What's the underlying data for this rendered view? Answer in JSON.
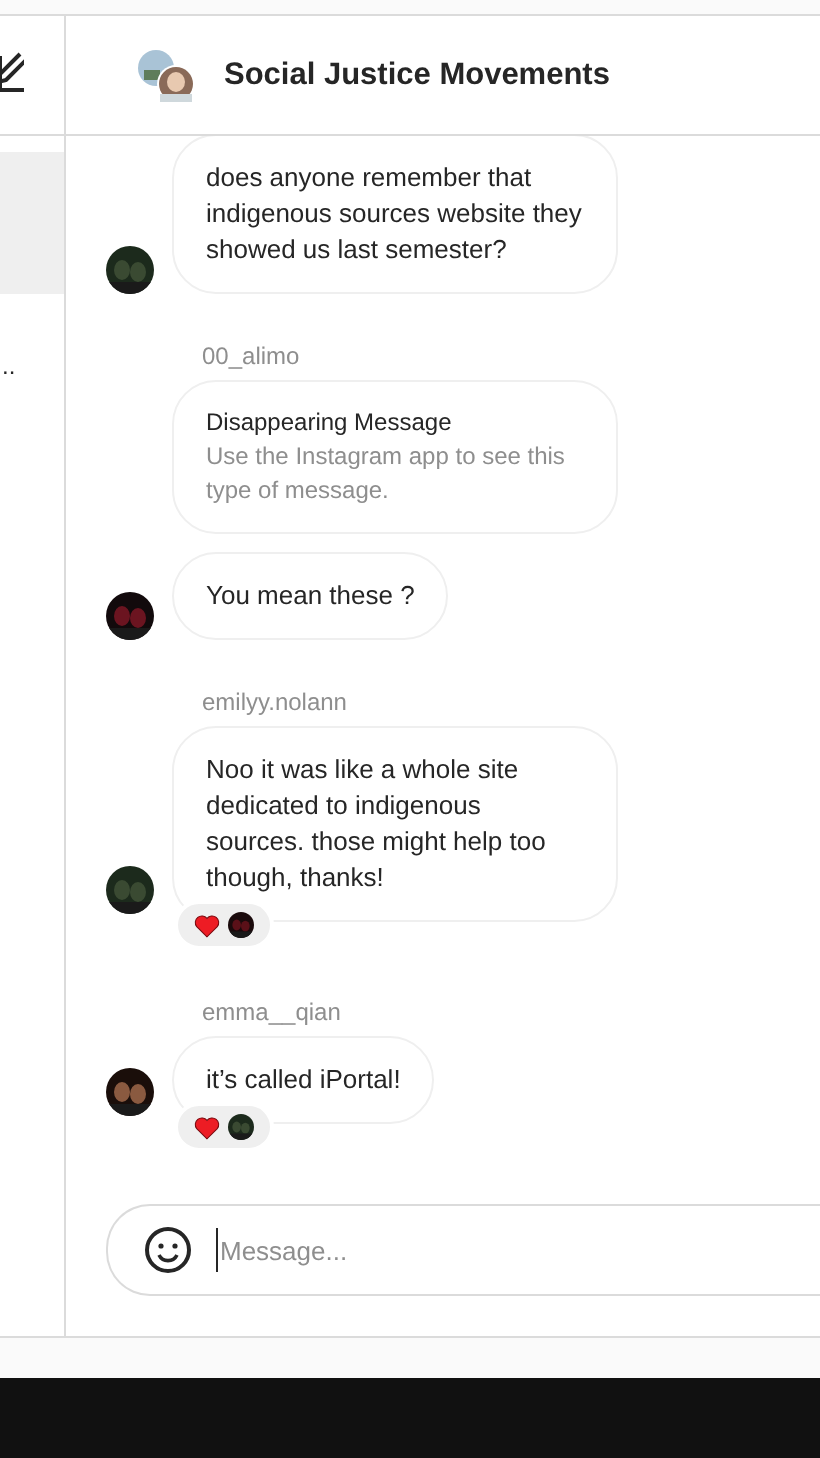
{
  "sidebar": {
    "items": [
      {
        "selected": true
      },
      {
        "selected": false,
        "preview": ".."
      }
    ]
  },
  "header": {
    "title": "Social Justice Movements"
  },
  "messages": [
    {
      "kind": "text",
      "text": "does anyone remember that indigenous sources website they showed us last semester?",
      "show_avatar": true,
      "reacted": false
    },
    {
      "sender": "00_alimo",
      "kind": "disappearing",
      "title": "Disappearing Message",
      "text": "Use the Instagram app to see this type of message.",
      "show_avatar": false,
      "reacted": false
    },
    {
      "kind": "text",
      "text": "You mean these ?",
      "show_avatar": true,
      "reacted": false
    },
    {
      "sender": "emilyy.nolann",
      "kind": "text",
      "text": "Noo it was like a whole site dedicated to indigenous sources. those might help too though, thanks!",
      "show_avatar": true,
      "reacted": true
    },
    {
      "sender": "emma__qian",
      "kind": "text",
      "text": "it’s called iPortal!",
      "show_avatar": true,
      "reacted": true
    }
  ],
  "composer": {
    "placeholder": "Message..."
  }
}
